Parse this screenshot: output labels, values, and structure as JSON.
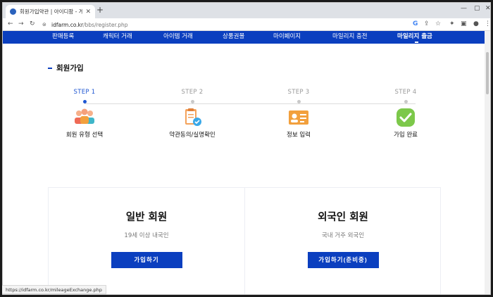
{
  "browser": {
    "tab_title": "회원가입약관 | 아이디팜 - 게정",
    "url_host": "idfarm.co.kr",
    "url_path": "/bbs/register.php",
    "status_url": "https://idfarm.co.kr/mileageExchange.php"
  },
  "nav": {
    "items": [
      {
        "label": "판매등록"
      },
      {
        "label": "캐릭터 거래"
      },
      {
        "label": "아이템 거래"
      },
      {
        "label": "상품권몰"
      },
      {
        "label": "마이페이지"
      },
      {
        "label": "마일리지 충전"
      },
      {
        "label": "마일리지 출금",
        "active": true
      }
    ]
  },
  "section_title": "회원가입",
  "steps": [
    {
      "label": "STEP 1",
      "name": "회원 유형 선택",
      "icon": "people-group-icon",
      "active": true
    },
    {
      "label": "STEP 2",
      "name": "약관동의/실명확인",
      "icon": "clipboard-check-icon",
      "active": false
    },
    {
      "label": "STEP 3",
      "name": "정보 입력",
      "icon": "id-card-icon",
      "active": false
    },
    {
      "label": "STEP 4",
      "name": "가입 완료",
      "icon": "check-circle-icon",
      "active": false
    }
  ],
  "cards": [
    {
      "title": "일반 회원",
      "subtitle": "19세 이상 내국인",
      "button": "가입하기"
    },
    {
      "title": "외국인 회원",
      "subtitle": "국내 거주 외국인",
      "button": "가입하기(준비중)"
    }
  ],
  "colors": {
    "brand": "#0b3fbf",
    "accent": "#1e56d2"
  }
}
